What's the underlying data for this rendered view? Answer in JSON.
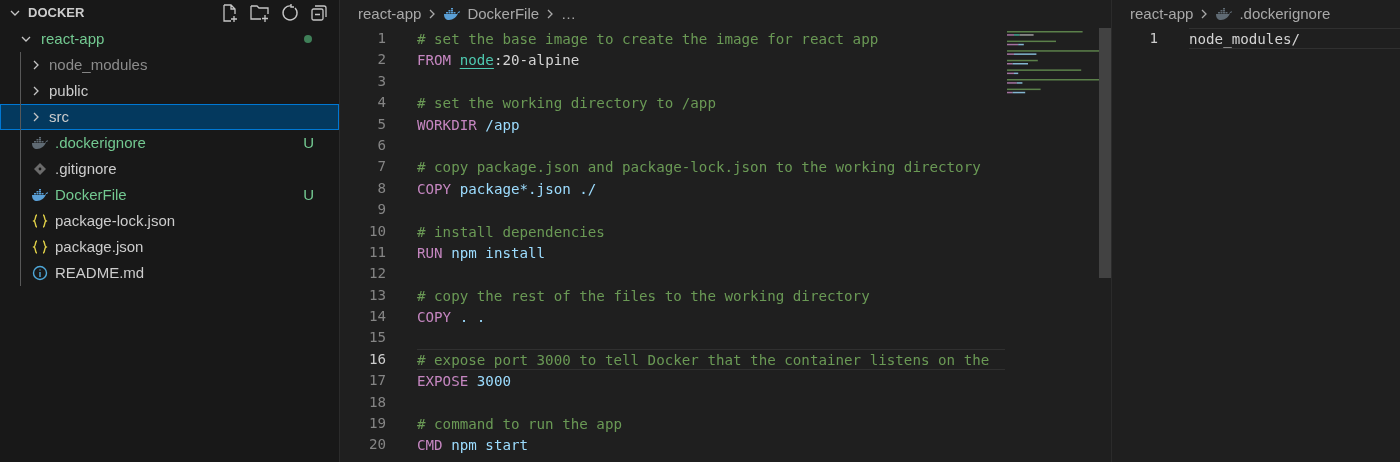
{
  "explorer": {
    "title": "DOCKER",
    "actions": [
      {
        "kind": "new-file"
      },
      {
        "kind": "new-folder"
      },
      {
        "kind": "refresh"
      },
      {
        "kind": "collapse"
      }
    ],
    "tree": [
      {
        "label": "react-app",
        "kind": "folder",
        "expanded": true,
        "changed": true,
        "ignored": false,
        "selected": false,
        "children": [
          {
            "label": "node_modules",
            "kind": "folder",
            "expanded": false,
            "changed": false,
            "ignored": true,
            "selected": false
          },
          {
            "label": "public",
            "kind": "folder",
            "expanded": false,
            "changed": false,
            "ignored": false,
            "selected": false
          },
          {
            "label": "src",
            "kind": "folder",
            "expanded": false,
            "changed": false,
            "ignored": false,
            "selected": true
          },
          {
            "label": ".dockerignore",
            "kind": "docker-dim",
            "changed": true,
            "ignored": false,
            "badge": "U",
            "selected": false
          },
          {
            "label": ".gitignore",
            "kind": "git",
            "changed": false,
            "ignored": false,
            "selected": false
          },
          {
            "label": "DockerFile",
            "kind": "docker",
            "changed": true,
            "ignored": false,
            "badge": "U",
            "selected": false
          },
          {
            "label": "package-lock.json",
            "kind": "json",
            "changed": false,
            "ignored": false,
            "selected": false
          },
          {
            "label": "package.json",
            "kind": "json",
            "changed": false,
            "ignored": false,
            "selected": false
          },
          {
            "label": "README.md",
            "kind": "info",
            "changed": false,
            "ignored": false,
            "selected": false
          }
        ]
      }
    ]
  },
  "editors": [
    {
      "breadcrumb": [
        "react-app",
        "DockerFile",
        "…"
      ],
      "minimap": true,
      "lines": [
        {
          "number": "1",
          "current": false,
          "tokens": [
            {
              "kind": "comment",
              "text": "# set the base image to create the image for react app"
            }
          ]
        },
        {
          "number": "2",
          "current": false,
          "tokens": [
            {
              "kind": "keyword",
              "text": "FROM "
            },
            {
              "kind": "link",
              "text": "node"
            },
            {
              "kind": "plain",
              "text": ":20-alpine"
            }
          ]
        },
        {
          "number": "3",
          "current": false
        },
        {
          "number": "4",
          "current": false,
          "tokens": [
            {
              "kind": "comment",
              "text": "# set the working directory to /app"
            }
          ]
        },
        {
          "number": "5",
          "current": false,
          "tokens": [
            {
              "kind": "keyword",
              "text": "WORKDIR "
            },
            {
              "kind": "value",
              "text": "/app"
            }
          ]
        },
        {
          "number": "6",
          "current": false
        },
        {
          "number": "7",
          "current": false,
          "tokens": [
            {
              "kind": "comment",
              "text": "# copy package.json and package-lock.json to the working directory"
            }
          ]
        },
        {
          "number": "8",
          "current": false,
          "tokens": [
            {
              "kind": "keyword",
              "text": "COPY "
            },
            {
              "kind": "value",
              "text": "package*.json ./"
            }
          ]
        },
        {
          "number": "9",
          "current": false
        },
        {
          "number": "10",
          "current": false,
          "tokens": [
            {
              "kind": "comment",
              "text": "# install dependencies"
            }
          ]
        },
        {
          "number": "11",
          "current": false,
          "tokens": [
            {
              "kind": "keyword",
              "text": "RUN "
            },
            {
              "kind": "value",
              "text": "npm install"
            }
          ]
        },
        {
          "number": "12",
          "current": false
        },
        {
          "number": "13",
          "current": false,
          "tokens": [
            {
              "kind": "comment",
              "text": "# copy the rest of the files to the working directory"
            }
          ]
        },
        {
          "number": "14",
          "current": false,
          "tokens": [
            {
              "kind": "keyword",
              "text": "COPY "
            },
            {
              "kind": "value",
              "text": ". ."
            }
          ]
        },
        {
          "number": "15",
          "current": false
        },
        {
          "number": "16",
          "current": true,
          "tokens": [
            {
              "kind": "comment",
              "text": "# expose port 3000 to tell Docker that the container listens on the"
            }
          ]
        },
        {
          "number": "17",
          "current": false,
          "tokens": [
            {
              "kind": "keyword",
              "text": "EXPOSE "
            },
            {
              "kind": "value",
              "text": "3000"
            }
          ]
        },
        {
          "number": "18",
          "current": false
        },
        {
          "number": "19",
          "current": false,
          "tokens": [
            {
              "kind": "comment",
              "text": "# command to run the app"
            }
          ]
        },
        {
          "number": "20",
          "current": false,
          "tokens": [
            {
              "kind": "keyword",
              "text": "CMD "
            },
            {
              "kind": "value",
              "text": "npm start"
            }
          ]
        }
      ]
    },
    {
      "breadcrumb": [
        "react-app",
        ".dockerignore"
      ],
      "minimap": false,
      "lines": [
        {
          "number": "1",
          "current": true,
          "tokens": [
            {
              "kind": "plain",
              "text": "node_modules/"
            }
          ]
        }
      ]
    }
  ]
}
